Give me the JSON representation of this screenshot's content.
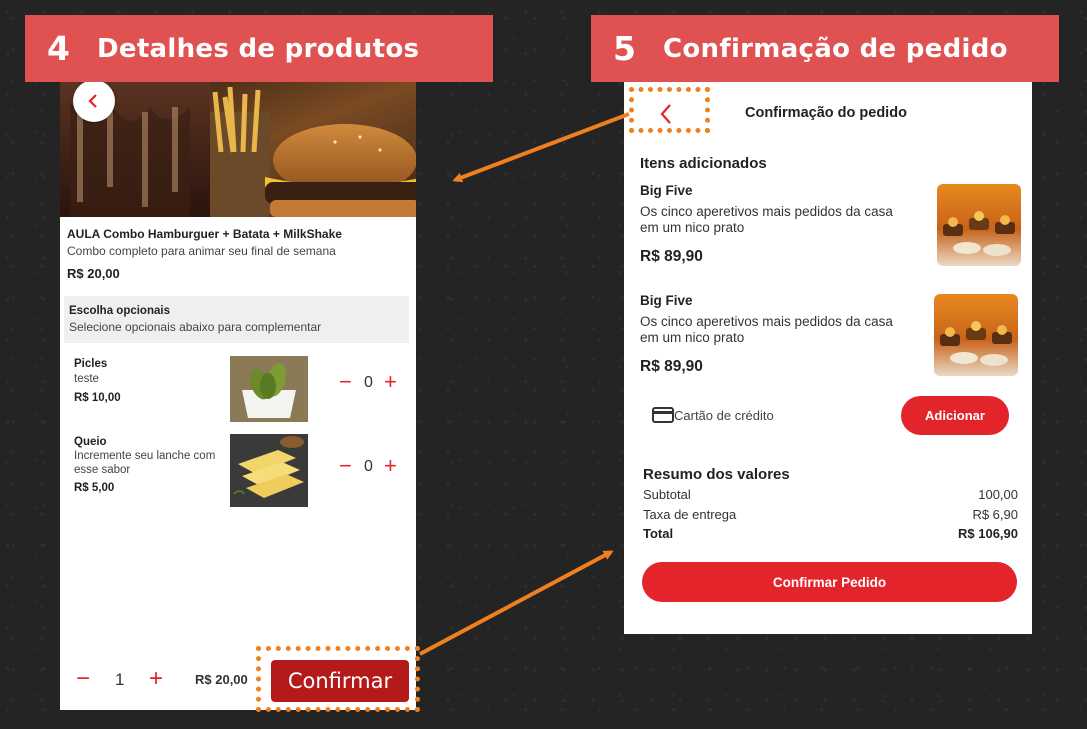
{
  "left_banner": {
    "number": "4",
    "title": "Detalhes de produtos"
  },
  "right_banner": {
    "number": "5",
    "title": "Confirmação de pedido"
  },
  "product": {
    "name": "AULA Combo Hamburguer + Batata + MilkShake",
    "description": "Combo completo para animar seu final de semana",
    "price": "R$ 20,00",
    "optional_title": "Escolha opcionais",
    "optional_subtitle": "Selecione opcionais abaixo para complementar",
    "options": [
      {
        "name": "Picles",
        "desc1": "teste",
        "desc2": "",
        "price": "R$ 10,00",
        "qty": "0"
      },
      {
        "name": "Queio",
        "desc1": "Incremente seu lanche com",
        "desc2": "esse sabor",
        "price": "R$ 5,00",
        "qty": "0"
      }
    ],
    "footer": {
      "qty": "1",
      "total": "R$ 20,00",
      "confirm_label": "Confirmar"
    }
  },
  "confirmation": {
    "header_title": "Confirmação do pedido",
    "section_title": "Itens adicionados",
    "items": [
      {
        "name": "Big Five",
        "desc1": "Os cinco aperetivos mais pedidos da casa",
        "desc2": "em um nico prato",
        "price": "R$ 89,90"
      },
      {
        "name": "Big Five",
        "desc1": "Os cinco aperetivos mais pedidos da casa",
        "desc2": "em um nico prato",
        "price": "R$ 89,90"
      }
    ],
    "payment_label": "Cartão de crédito",
    "add_label": "Adicionar",
    "summary": {
      "title": "Resumo dos valores",
      "subtotal_label": "Subtotal",
      "subtotal_value": "100,00",
      "fee_label": "Taxa de entrega",
      "fee_value": "R$ 6,90",
      "total_label": "Total",
      "total_value": "R$ 106,90"
    },
    "confirm_label": "Confirmar Pedido"
  },
  "colors": {
    "banner": "#e05252",
    "accent": "#e3242b",
    "highlight": "#f07f1f",
    "confirm_button": "#b51a1a"
  }
}
